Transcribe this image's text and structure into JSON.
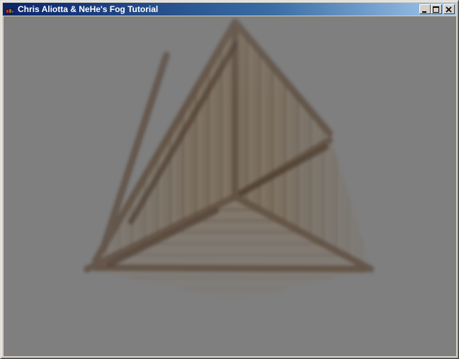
{
  "window": {
    "title": "Chris Aliotta & NeHe's Fog Tutorial",
    "icon": "opengl-app-icon",
    "buttons": [
      "minimize",
      "maximize",
      "close"
    ]
  },
  "scene": {
    "object": "wooden-crate",
    "fog_color": "#808080",
    "wood_color": "#7a6a58"
  }
}
